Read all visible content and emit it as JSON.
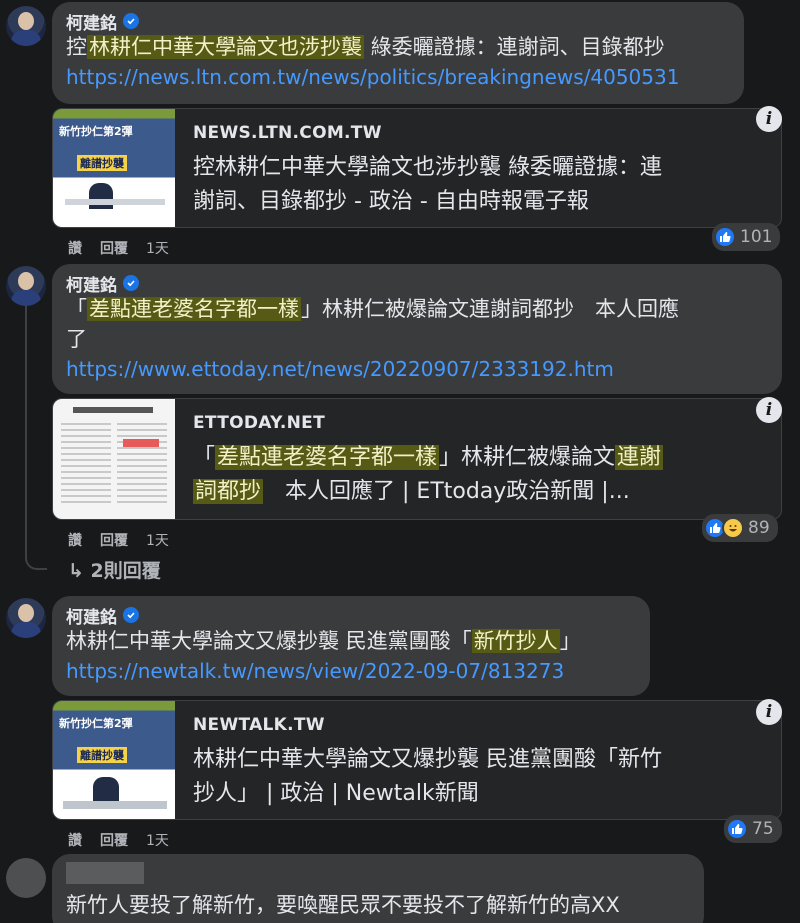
{
  "comments": [
    {
      "author": "柯建銘",
      "text_pre": "控",
      "text_hl": "林耕仁中華大學論文也涉抄襲",
      "text_post": " 綠委曬證據：連謝詞、目錄都抄",
      "link": "https://news.ltn.com.tw/news/politics/breakingnews/4050531",
      "card": {
        "domain": "NEWS.LTN.COM.TW",
        "title_line1": "控林耕仁中華大學論文也涉抄襲 綠委曬證據：連",
        "title_line2": "謝詞、目錄都抄 - 政治 - 自由時報電子報",
        "thumb_text_1": "新竹抄仁第2彈",
        "thumb_text_2": "離譜抄襲"
      },
      "actions": {
        "like": "讚",
        "reply": "回覆",
        "time": "1天"
      },
      "reaction_count": "101"
    },
    {
      "author": "柯建銘",
      "text_pre": "「",
      "text_hl": "差點連老婆名字都一樣",
      "text_post_l1": "」林耕仁被爆論文連謝詞都抄　本人回應",
      "text_post_l2": "了",
      "link": "https://www.ettoday.net/news/20220907/2333192.htm",
      "card": {
        "domain": "ETTODAY.NET",
        "t1_pre": "「",
        "t1_hl": "差點連老婆名字都一樣",
        "t1_mid": "」林耕仁被爆論文",
        "t1_hl2": "連謝",
        "t2_hl": "詞都抄",
        "t2_post": "　本人回應了 | ETtoday政治新聞 |..."
      },
      "actions": {
        "like": "讚",
        "reply": "回覆",
        "time": "1天"
      },
      "reaction_count": "89"
    },
    {
      "author": "柯建銘",
      "text_pre": "林耕仁中華大學論文又爆抄襲 民進黨團酸「",
      "text_hl": "新竹抄人",
      "text_post": "」",
      "link": "https://newtalk.tw/news/view/2022-09-07/813273",
      "card": {
        "domain": "NEWTALK.TW",
        "title_line1": "林耕仁中華大學論文又爆抄襲 民進黨團酸「新竹",
        "title_line2": "抄人」 | 政治 | Newtalk新聞",
        "thumb_text_1": "新竹抄仁第2彈",
        "thumb_text_2": "離譜抄襲"
      },
      "actions": {
        "like": "讚",
        "reply": "回覆",
        "time": "1天"
      },
      "reaction_count": "75"
    }
  ],
  "replies_label": "2則回覆",
  "last_comment": {
    "text": "新竹人要投了解新竹，要喚醒民眾不要投不了解新竹的高XX"
  },
  "colors": {
    "background": "#18191a",
    "bubble": "#3a3b3c",
    "link": "#4599ff",
    "highlight": "#565a14"
  }
}
